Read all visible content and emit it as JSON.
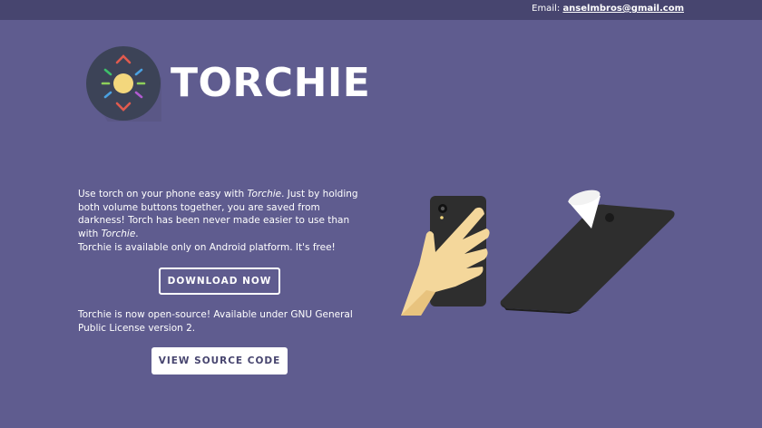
{
  "topbar": {
    "email_label": "Email:",
    "email_address": "anselmbros@gmail.com"
  },
  "brand": {
    "name": "TORCHIE",
    "logo_icon": "torch-sun-icon"
  },
  "intro": {
    "text_before": "Use torch on your phone easy with ",
    "emph1": "Torchie",
    "text_middle": ". Just by holding both volume buttons together, you are saved from darkness! Torch has been never made easier to use than with ",
    "emph2": "Torchie",
    "text_after": "."
  },
  "availability": "Torchie is available only on Android platform. It's free!",
  "download_button": "DOWNLOAD NOW",
  "opensource_text": "Torchie is now open-source! Available under GNU General Public License version 2.",
  "source_button": "VIEW SOURCE CODE",
  "colors": {
    "background": "#5f5c8f",
    "topbar": "#47456f",
    "phone": "#2e2e2e",
    "hand": "#f4d79b",
    "logo_circle": "#3c4357"
  }
}
